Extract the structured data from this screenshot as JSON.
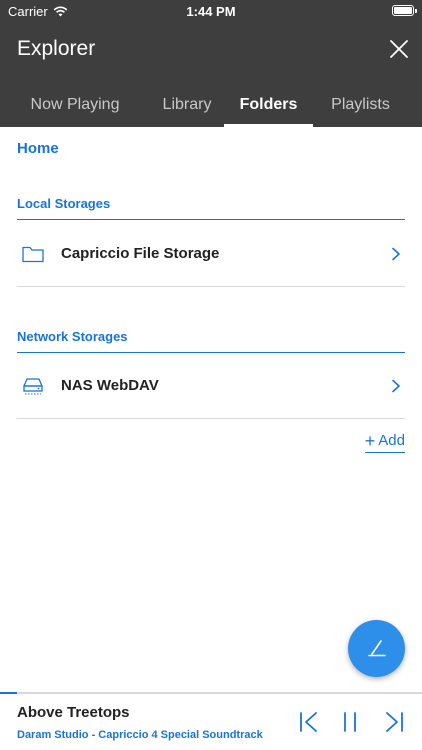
{
  "status": {
    "carrier": "Carrier",
    "time": "1:44 PM"
  },
  "header": {
    "title": "Explorer"
  },
  "tabs": [
    {
      "label": "Now Playing"
    },
    {
      "label": "Library"
    },
    {
      "label": "Folders"
    },
    {
      "label": "Playlists"
    }
  ],
  "active_tab": "Folders",
  "breadcrumb": "Home",
  "local": {
    "header": "Local Storages",
    "items": [
      {
        "label": "Capriccio File Storage",
        "icon": "folder-icon"
      }
    ]
  },
  "network": {
    "header": "Network Storages",
    "items": [
      {
        "label": "NAS WebDAV",
        "icon": "nas-drive-icon"
      }
    ]
  },
  "add_label": "Add",
  "player": {
    "title": "Above Treetops",
    "subtitle": "Daram Studio - Capriccio 4 Special Soundtrack",
    "progress": 0.04
  },
  "colors": {
    "header_bg": "#3e3e3e",
    "accent": "#1a74d6",
    "fab": "#2d8fe9"
  }
}
